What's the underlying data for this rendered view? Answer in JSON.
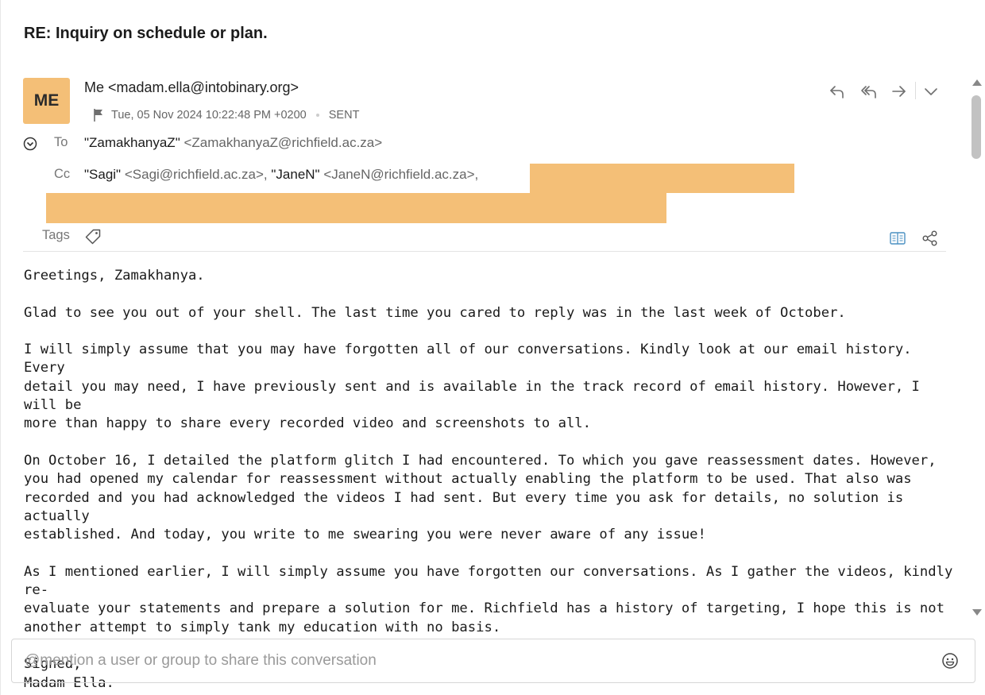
{
  "email": {
    "subject": "RE: Inquiry on schedule or plan.",
    "avatar_initials": "ME",
    "from": "Me <madam.ella@intobinary.org>",
    "date": "Tue, 05 Nov 2024 10:22:48 PM +0200",
    "status": "SENT",
    "to_label": "To",
    "to_name": "\"ZamakhanyaZ\"",
    "to_email": "<ZamakhanyaZ@richfield.ac.za>",
    "cc_label": "Cc",
    "cc1_name": "\"Sagi\"",
    "cc1_email": "<Sagi@richfield.ac.za>",
    "cc_sep": ", ",
    "cc2_name": "\"JaneN\"",
    "cc2_email": "<JaneN@richfield.ac.za>",
    "cc_trail": ",",
    "tags_label": "Tags",
    "body": "Greetings, Zamakhanya.\n\nGlad to see you out of your shell. The last time you cared to reply was in the last week of October.\n\nI will simply assume that you may have forgotten all of our conversations. Kindly look at our email history. Every\ndetail you may need, I have previously sent and is available in the track record of email history. However, I will be\nmore than happy to share every recorded video and screenshots to all.\n\nOn October 16, I detailed the platform glitch I had encountered. To which you gave reassessment dates. However,\nyou had opened my calendar for reassessment without actually enabling the platform to be used. That also was\nrecorded and you had acknowledged the videos I had sent. But every time you ask for details, no solution is actually\nestablished. And today, you write to me swearing you were never aware of any issue!\n\nAs I mentioned earlier, I will simply assume you have forgotten our conversations. As I gather the videos, kindly re-\nevaluate your statements and prepare a solution for me. Richfield has a history of targeting, I hope this is not\nanother attempt to simply tank my education with no basis.\n\nSigned,\nMadam Ella."
  },
  "composer": {
    "placeholder": "@mention a user or group to share this conversation"
  },
  "colors": {
    "avatar_bg": "#f4bf77",
    "redaction": "#f4bf77",
    "icon_gray": "#6f6f6f",
    "link_blue": "#4a90c2"
  },
  "icons": {
    "reply": "reply-icon",
    "reply_all": "reply-all-icon",
    "forward": "forward-icon",
    "more": "chevron-down-icon",
    "flag": "flag-icon",
    "collapse": "collapse-circle-icon",
    "tag": "tag-icon",
    "reader": "reader-view-icon",
    "share": "share-icon",
    "emoji": "emoji-icon"
  }
}
